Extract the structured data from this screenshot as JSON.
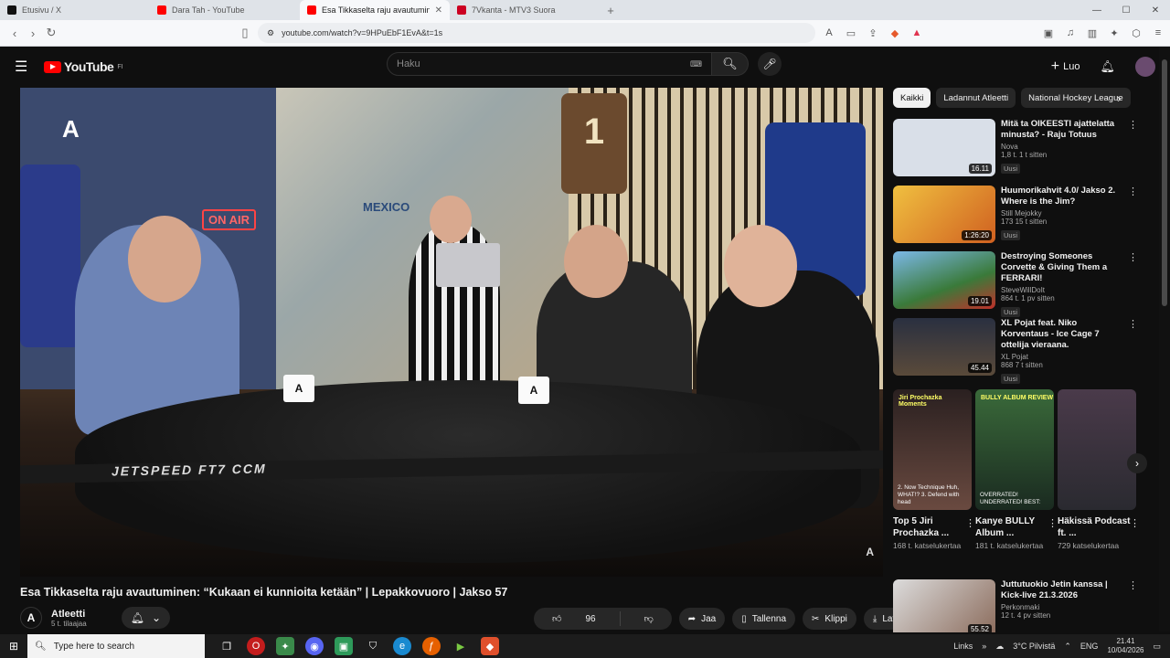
{
  "browser": {
    "tabs": [
      {
        "label": "Etusivu / X",
        "color": "#111111"
      },
      {
        "label": "Dara Tah - YouTube",
        "color": "#ff0000"
      },
      {
        "label": "Esa Tikkaselta raju avautuminen",
        "color": "#ff0000",
        "active": true
      },
      {
        "label": "7Vkanta - MTV3 Suora",
        "color": "#cc0022"
      }
    ],
    "url": "youtube.com/watch?v=9HPuEbF1EvA&t=1s"
  },
  "youtube": {
    "logo_text": "YouTube",
    "region": "FI",
    "search_placeholder": "Haku",
    "create_label": "Luo"
  },
  "video": {
    "title": "Esa Tikkaselta raju avautuminen: “Kukaan ei kunnioita ketään” | Lepakkovuoro | Jakso 57",
    "on_air": "ON AIR",
    "jersey_number": "1",
    "banner_text": "MEXICO",
    "stick_text": "JETSPEED FT7   CCM",
    "channel_logo": "A",
    "channel": "Atleetti",
    "subscribers": "5 t. tilaajaa",
    "likes": "96",
    "share": "Jaa",
    "save": "Tallenna",
    "clip": "Klippi",
    "download": "Lataa"
  },
  "chips": [
    "Kaikki",
    "Ladannut Atleetti",
    "National Hockey League"
  ],
  "recommendations": [
    {
      "title": "Mitä ta OIKEESTI ajattelatta minusta? - Raju Totuus",
      "channel": "Nova",
      "meta": "1,8 t.  1 t sitten",
      "badge": "Uusi",
      "duration": "16.11",
      "color": "#d9dfe8"
    },
    {
      "title": "Huumorikahvit 4.0/ Jakso 2. Where is the Jim?",
      "channel": "Still Mejokky",
      "meta": "173  15 t sitten",
      "badge": "Uusi",
      "duration": "1:26:20",
      "color": "#e2a23a"
    },
    {
      "title": "Destroying Someones Corvette & Giving Them a FERRARI!",
      "channel": "SteveWillDoIt",
      "meta": "864 t.  1 pv sitten",
      "badge": "Uusi",
      "duration": "19.01",
      "color": "#5aa0d8"
    },
    {
      "title": "XL Pojat feat. Niko Korventaus - Ice Cage 7 ottelija vieraana.",
      "channel": "XL Pojat",
      "meta": "868  7 t sitten",
      "badge": "Uusi",
      "duration": "45.44",
      "color": "#3a4250"
    }
  ],
  "shorts": [
    {
      "title": "Top 5 Jiri Prochazka ...",
      "views": "168 t. katselukertaa",
      "color": "#3a2a28",
      "top": "Jiri Prochazka Moments",
      "bottom": "2. Now Technique Huh, WHAT!? 3. Defend with head"
    },
    {
      "title": "Kanye BULLY Album ...",
      "views": "181 t. katselukertaa",
      "color": "#2d4a3a",
      "top": "BULLY ALBUM REVIEW",
      "bottom": "OVERRATED! UNDERRATED! BEST:"
    },
    {
      "title": "Häkissä Podcast ft. ...",
      "views": "729 katselukertaa",
      "color": "#4a3a3a",
      "top": "",
      "bottom": ""
    }
  ],
  "bottom_rec": {
    "title": "Juttutuokio Jetin kanssa | Kick-live 21.3.2026",
    "channel": "Perkonmaki",
    "meta": "12 t.  4 pv sitten",
    "duration": "55.52"
  },
  "taskbar": {
    "search_placeholder": "Type here to search",
    "links": "Links",
    "weather": "3°C Pilvistä",
    "lang": "ENG",
    "time": "21.41",
    "date": "10/04/2026"
  }
}
